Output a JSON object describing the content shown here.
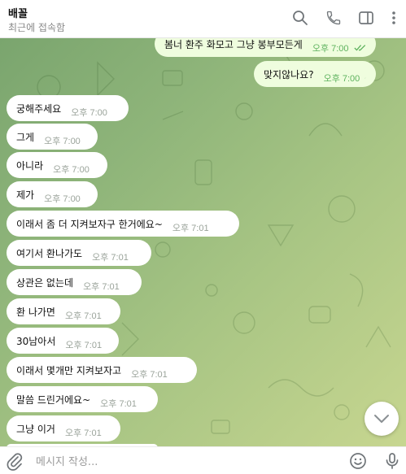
{
  "header": {
    "title": "배꼴",
    "subtitle": "최근에 접속함",
    "icons": [
      "search-icon",
      "phone-icon",
      "more-vert-icon",
      "sidebar-toggle-icon"
    ]
  },
  "messages": [
    {
      "dir": "out",
      "text": "봄너 환주 화모고 그냥 봉부모든게",
      "time": "오후 7:00",
      "read": true
    },
    {
      "dir": "out",
      "text": "맞지않나요?",
      "time": "오후 7:00",
      "read": true
    },
    {
      "dir": "in",
      "text": "궁해주세요",
      "time": "오후 7:00"
    },
    {
      "dir": "in",
      "text": "그게",
      "time": "오후 7:00"
    },
    {
      "dir": "in",
      "text": "아니라",
      "time": "오후 7:00"
    },
    {
      "dir": "in",
      "text": "제가",
      "time": "오후 7:00"
    },
    {
      "dir": "in",
      "text": "이래서 좀 더 지켜보자구 한거에요~",
      "time": "오후 7:01"
    },
    {
      "dir": "in",
      "text": "여기서 환나가도",
      "time": "오후 7:01"
    },
    {
      "dir": "in",
      "text": "상관은 없는데",
      "time": "오후 7:01"
    },
    {
      "dir": "in",
      "text": "환 나가면",
      "time": "오후 7:01"
    },
    {
      "dir": "in",
      "text": "30남아서",
      "time": "오후 7:01"
    },
    {
      "dir": "in",
      "text": "이래서 몇개만 지켜보자고",
      "time": "오후 7:01"
    },
    {
      "dir": "in",
      "text": "말씀 드린거에요~",
      "time": "오후 7:01"
    },
    {
      "dir": "in",
      "text": "그냥 이거",
      "time": "오후 7:01"
    }
  ],
  "composer": {
    "placeholder": "메시지 작성..."
  },
  "colors": {
    "bubble_in": "#ffffff",
    "bubble_out": "#effdde",
    "read_check": "#5eb25e",
    "background_start": "#7aa56e",
    "background_end": "#c7d690"
  }
}
